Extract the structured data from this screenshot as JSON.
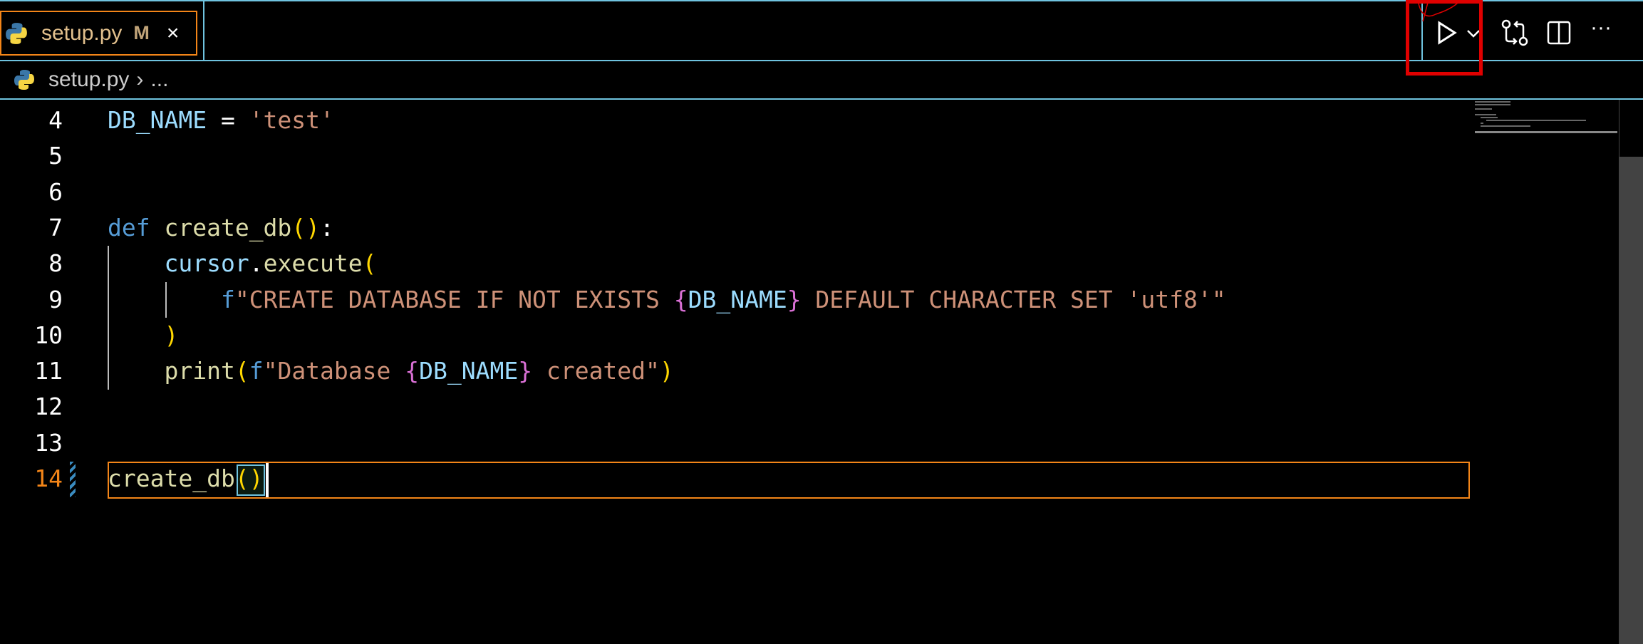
{
  "tab": {
    "label": "setup.py",
    "status": "M",
    "close": "×"
  },
  "breadcrumb": {
    "file": "setup.py",
    "sep": "›",
    "rest": "..."
  },
  "toolbar": {
    "run": "run-python-file",
    "more": "···"
  },
  "lines": [
    {
      "n": "4",
      "parts": [
        [
          "var",
          "DB_NAME"
        ],
        [
          "plain",
          " = "
        ],
        [
          "str",
          "'test'"
        ]
      ]
    },
    {
      "n": "5",
      "parts": []
    },
    {
      "n": "6",
      "parts": []
    },
    {
      "n": "7",
      "parts": [
        [
          "kw",
          "def "
        ],
        [
          "fn",
          "create_db"
        ],
        [
          "br",
          "()"
        ],
        [
          "plain",
          ":"
        ]
      ]
    },
    {
      "n": "8",
      "parts": [
        [
          "plain",
          "    "
        ],
        [
          "var",
          "cursor"
        ],
        [
          "plain",
          "."
        ],
        [
          "fn",
          "execute"
        ],
        [
          "br",
          "("
        ]
      ]
    },
    {
      "n": "9",
      "parts": [
        [
          "plain",
          "        "
        ],
        [
          "kw",
          "f"
        ],
        [
          "str",
          "\"CREATE DATABASE IF NOT EXISTS "
        ],
        [
          "br2",
          "{"
        ],
        [
          "var",
          "DB_NAME"
        ],
        [
          "br2",
          "}"
        ],
        [
          "str",
          " DEFAULT CHARACTER SET 'utf8'\""
        ]
      ]
    },
    {
      "n": "10",
      "parts": [
        [
          "plain",
          "    "
        ],
        [
          "br",
          ")"
        ]
      ]
    },
    {
      "n": "11",
      "parts": [
        [
          "plain",
          "    "
        ],
        [
          "fn",
          "print"
        ],
        [
          "br",
          "("
        ],
        [
          "kw",
          "f"
        ],
        [
          "str",
          "\"Database "
        ],
        [
          "br2",
          "{"
        ],
        [
          "var",
          "DB_NAME"
        ],
        [
          "br2",
          "}"
        ],
        [
          "str",
          " created\""
        ],
        [
          "br",
          ")"
        ]
      ]
    },
    {
      "n": "12",
      "parts": []
    },
    {
      "n": "13",
      "parts": []
    },
    {
      "n": "14",
      "parts": [
        [
          "fn",
          "create_db"
        ],
        [
          "br",
          "()"
        ]
      ]
    }
  ]
}
